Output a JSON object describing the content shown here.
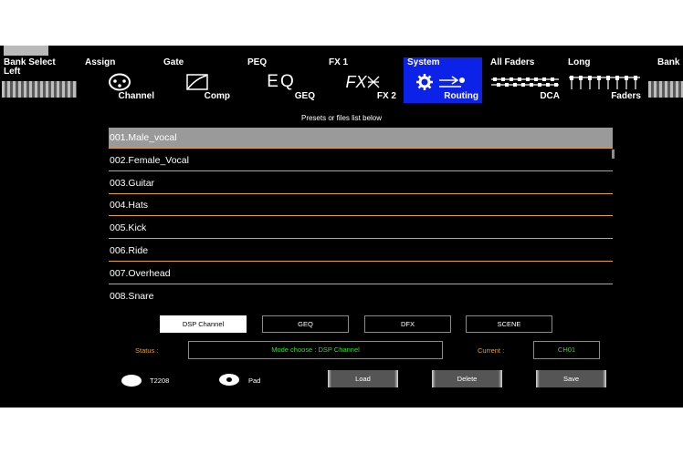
{
  "toolbar": {
    "bank_left": {
      "label": "Bank Select\nLeft"
    },
    "assign": {
      "top": "Assign",
      "bottom": "Channel",
      "icon": "xlr-connector-icon"
    },
    "gate": {
      "top": "Gate",
      "bottom": "Comp",
      "icon": "compressor-curve-icon"
    },
    "peq": {
      "top": "PEQ",
      "bottom": "GEQ",
      "icon_text": "EQ"
    },
    "fx": {
      "top": "FX 1",
      "bottom": "FX 2",
      "icon_text": "FX"
    },
    "system": {
      "top": "System",
      "bottom": "Routing",
      "icon": "gear-routing-icon"
    },
    "all_faders": {
      "top": "All Faders",
      "bottom": "DCA",
      "icon": "faders-grid-icon"
    },
    "long": {
      "top": "Long",
      "bottom": "Faders",
      "icon": "long-faders-icon"
    },
    "bank_right": {
      "label": "Bank"
    }
  },
  "presets_label": "Presets or files list below",
  "presets": [
    "001.Male_vocal",
    "002.Female_Vocal",
    "003.Guitar",
    "004.Hats",
    "005.Kick",
    "006.Ride",
    "007.Overhead",
    "008.Snare"
  ],
  "selected_preset": 0,
  "type_buttons": [
    "DSP Channel",
    "GEQ",
    "DFX",
    "SCENE"
  ],
  "active_type": 0,
  "status": {
    "label": "Status :",
    "value": "Mode choose : DSP Channel"
  },
  "current": {
    "label": "Current :",
    "value": "CH01"
  },
  "radios": [
    {
      "label": "T2208",
      "selected": false
    },
    {
      "label": "Pad",
      "selected": true
    }
  ],
  "actions": {
    "load": "Load",
    "delete": "Delete",
    "save": "Save"
  },
  "colors": {
    "selected_tab": "#0d22e8",
    "row_divider": "#e8a22a",
    "status_text": "#27e02a",
    "label_orange": "#e8a22a"
  }
}
